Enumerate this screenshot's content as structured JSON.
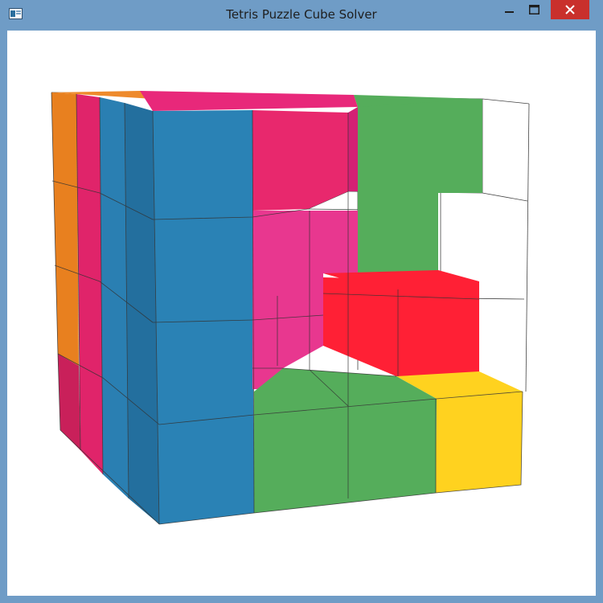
{
  "window": {
    "title": "Tetris Puzzle Cube Solver",
    "icon": "app-window-icon",
    "caption_buttons": {
      "minimize_icon": "minimize-icon",
      "maximize_icon": "maximize-icon",
      "close_icon": "close-icon"
    }
  },
  "scene": {
    "description_icon": "3d-cube-viewport",
    "piece_colors": {
      "orange": "#e8801f",
      "crimson": "#c9205a",
      "pink": "#e8286d",
      "magenta": "#e8378f",
      "blue": "#2a82b5",
      "dark_blue": "#1f5f87",
      "green": "#55ad5b",
      "red": "#ff2035",
      "yellow": "#ffd21f"
    },
    "accent": {
      "titlebar": "#6f9cc6",
      "close_button": "#c9302c"
    }
  }
}
